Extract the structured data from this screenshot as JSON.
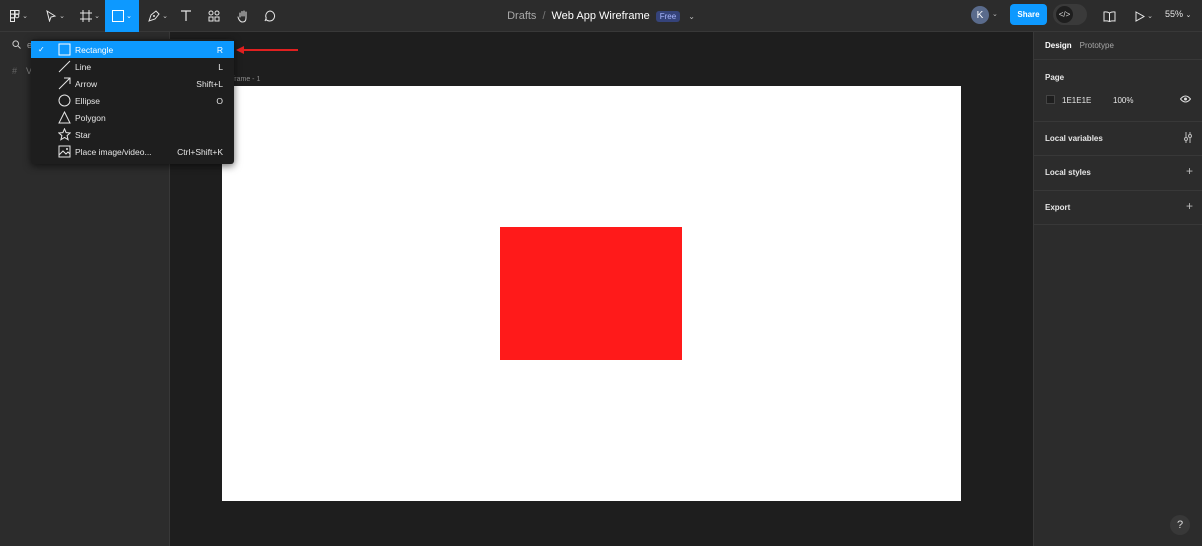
{
  "topbar": {
    "tools": [
      {
        "name": "main-menu",
        "icon": "figma-logo-icon"
      },
      {
        "name": "move-tool",
        "icon": "cursor-icon"
      },
      {
        "name": "frame-tool",
        "icon": "hash-frame-icon"
      },
      {
        "name": "shape-tool",
        "icon": "rectangle-icon",
        "active": true
      },
      {
        "name": "pen-tool",
        "icon": "pen-icon"
      },
      {
        "name": "text-tool",
        "icon": "text-icon"
      },
      {
        "name": "resources",
        "icon": "components-icon"
      },
      {
        "name": "hand-tool",
        "icon": "hand-icon"
      },
      {
        "name": "comment-tool",
        "icon": "comment-icon"
      }
    ],
    "breadcrumb": {
      "drafts": "Drafts",
      "separator": "/",
      "title": "Web App Wireframe",
      "badge": "Free"
    },
    "avatar_initial": "K",
    "share_label": "Share",
    "zoom": "55%"
  },
  "left_panel": {
    "search_fragment": "e",
    "layer_fragment": "V"
  },
  "shape_menu": {
    "items": [
      {
        "label": "Rectangle",
        "shortcut": "R",
        "icon": "rectangle-icon",
        "selected": true
      },
      {
        "label": "Line",
        "shortcut": "L",
        "icon": "line-icon",
        "selected": false
      },
      {
        "label": "Arrow",
        "shortcut": "Shift+L",
        "icon": "arrow-icon",
        "selected": false
      },
      {
        "label": "Ellipse",
        "shortcut": "O",
        "icon": "ellipse-icon",
        "selected": false
      },
      {
        "label": "Polygon",
        "shortcut": "",
        "icon": "polygon-icon",
        "selected": false
      },
      {
        "label": "Star",
        "shortcut": "",
        "icon": "star-icon",
        "selected": false
      },
      {
        "label": "Place image/video...",
        "shortcut": "Ctrl+Shift+K",
        "icon": "image-icon",
        "selected": false
      }
    ]
  },
  "canvas": {
    "frame_label": "rframe - 1",
    "frame_color": "#FFFFFF",
    "rectangle_color": "#FF1A1A"
  },
  "right_panel": {
    "tabs": [
      "Design",
      "Prototype"
    ],
    "page": {
      "title": "Page",
      "color_hex": "1E1E1E",
      "opacity": "100%"
    },
    "sections": [
      "Local variables",
      "Local styles",
      "Export"
    ]
  },
  "colors": {
    "accent": "#0D99FF",
    "annotation_arrow": "#E02020"
  }
}
